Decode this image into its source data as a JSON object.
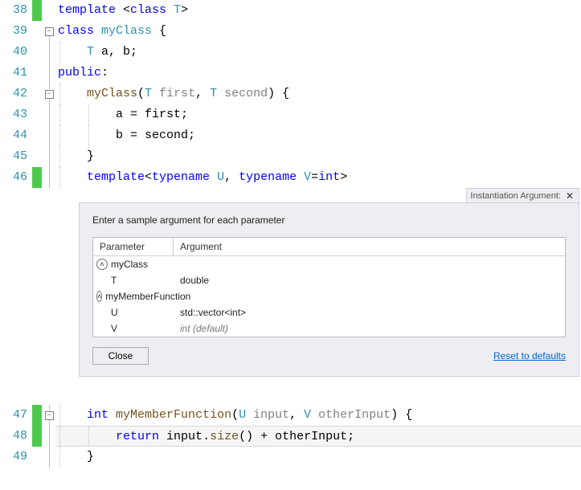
{
  "popup": {
    "tab_title": "Instantiation Argument:",
    "instruction": "Enter a sample argument for each parameter",
    "columns": {
      "param": "Parameter",
      "arg": "Argument"
    },
    "rows": [
      {
        "kind": "group",
        "param": "myClass",
        "arg": ""
      },
      {
        "kind": "child",
        "param": "T",
        "arg": "double"
      },
      {
        "kind": "group",
        "param": "myMemberFunction",
        "arg": ""
      },
      {
        "kind": "child",
        "param": "U",
        "arg": "std::vector<int>"
      },
      {
        "kind": "child-default",
        "param": "V",
        "arg": "int (default)"
      }
    ],
    "close_label": "Close",
    "reset_label": "Reset to defaults"
  },
  "lines": {
    "l38": "38",
    "l39": "39",
    "l40": "40",
    "l41": "41",
    "l42": "42",
    "l43": "43",
    "l44": "44",
    "l45": "45",
    "l46": "46",
    "l47": "47",
    "l48": "48",
    "l49": "49"
  },
  "code": {
    "t38": {
      "template": "template",
      "lt": " <",
      "class": "class",
      "sp": " ",
      "T": "T",
      "gt": ">"
    },
    "t39": {
      "class": "class",
      "sp": " ",
      "name": "myClass",
      "br": " {"
    },
    "t40": {
      "indent": "    ",
      "T": "T",
      "rest": " a, b;"
    },
    "t41": {
      "public": "public",
      "colon": ":"
    },
    "t42": {
      "indent": "    ",
      "ctor": "myClass",
      "lp": "(",
      "T1": "T",
      "p1": " first",
      "c": ", ",
      "T2": "T",
      "p2": " second",
      "rp": ") {"
    },
    "t43": {
      "indent": "        ",
      "body": "a = first;"
    },
    "t44": {
      "indent": "        ",
      "body": "b = second;"
    },
    "t45": {
      "indent": "    ",
      "body": "}"
    },
    "t46": {
      "indent": "    ",
      "template": "template",
      "lt": "<",
      "typename1": "typename",
      "sp1": " ",
      "U": "U",
      "c": ", ",
      "typename2": "typename",
      "sp2": " ",
      "V": "V",
      "eq": "=",
      "int": "int",
      "gt": ">"
    },
    "t47": {
      "indent": "    ",
      "int": "int",
      "sp": " ",
      "fn": "myMemberFunction",
      "lp": "(",
      "U": "U",
      "p1": " input",
      "c": ", ",
      "V": "V",
      "p2": " otherInput",
      "rp": ") {"
    },
    "t48": {
      "indent": "        ",
      "return": "return",
      "sp": " ",
      "obj": "input",
      "dot": ".",
      "meth": "size",
      "call": "() + otherInput;"
    },
    "t49": {
      "indent": "    ",
      "body": "}"
    }
  }
}
